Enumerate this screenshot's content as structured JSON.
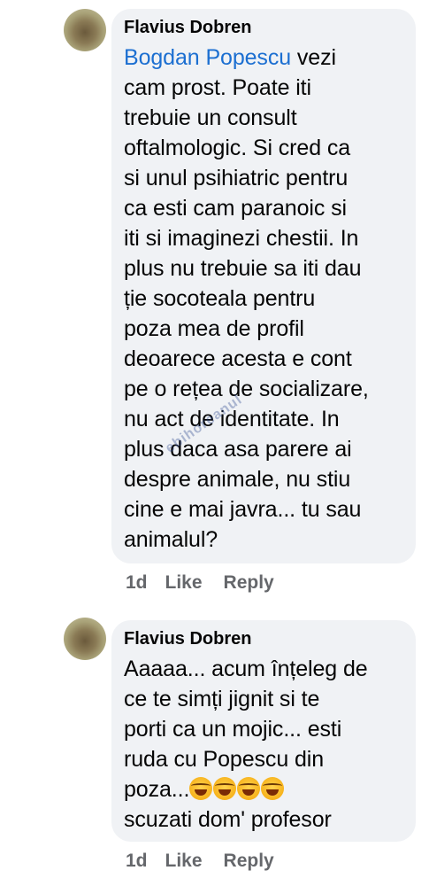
{
  "comments": [
    {
      "author": "Flavius Dobren",
      "mention": "Bogdan Popescu",
      "text": " vezi\ncam prost. Poate iti\ntrebuie un consult\noftalmologic. Si cred ca\nsi unul psihiatric pentru\nca esti cam paranoic si\niti si imaginezi chestii. In\nplus nu trebuie sa iti dau\nție socoteala pentru\npoza mea de profil\ndeoarece acesta e cont\npe o rețea de socializare,\nnu act de identitate. In\nplus daca asa parere ai\ndespre animale, nu stiu\ncine e mai javra... tu sau\nanimalul?",
      "time": "1d",
      "like": "Like",
      "reply": "Reply"
    },
    {
      "author": "Flavius Dobren",
      "text_before_emoji": "Aaaaa... acum înțeleg de\nce te simți jignit si te\nporti ca un mojic... esti\nruda cu Popescu din\npoza...",
      "emoji": [
        "rolling-on-floor-laughing",
        "rolling-on-floor-laughing",
        "rolling-on-floor-laughing",
        "rolling-on-floor-laughing"
      ],
      "text_after_emoji": "\nscuzati dom' profesor",
      "time": "1d",
      "like": "Like",
      "reply": "Reply"
    }
  ],
  "watermark": "ebihoreanul",
  "colors": {
    "bubble": "#f0f2f5",
    "mention": "#1c6fd1",
    "action": "#65676b"
  }
}
